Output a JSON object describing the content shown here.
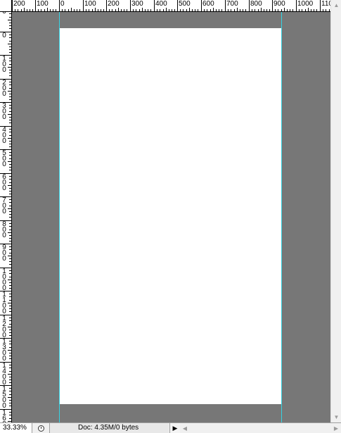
{
  "rulers": {
    "top_labels": [
      "200",
      "100",
      "0",
      "100",
      "200",
      "300",
      "400",
      "500",
      "600",
      "700",
      "800",
      "900",
      "1000",
      "1100"
    ],
    "left_labels": [
      "0",
      "0",
      "100",
      "200",
      "300",
      "400",
      "500",
      "600",
      "700",
      "800",
      "900",
      "1000",
      "1100",
      "1200",
      "1300",
      "1400",
      "1500",
      "1600"
    ]
  },
  "canvas": {
    "background": "#777777",
    "page_color": "#ffffff",
    "guide_color": "#35d2e2"
  },
  "status": {
    "zoom": "33.33%",
    "doc_info": "Doc: 4.35M/0 bytes",
    "menu_arrow": "▶"
  },
  "icons": {
    "clock": "clock-icon",
    "scroll_up": "▲",
    "scroll_down": "▼",
    "scroll_left": "◀",
    "scroll_right": "▶"
  }
}
